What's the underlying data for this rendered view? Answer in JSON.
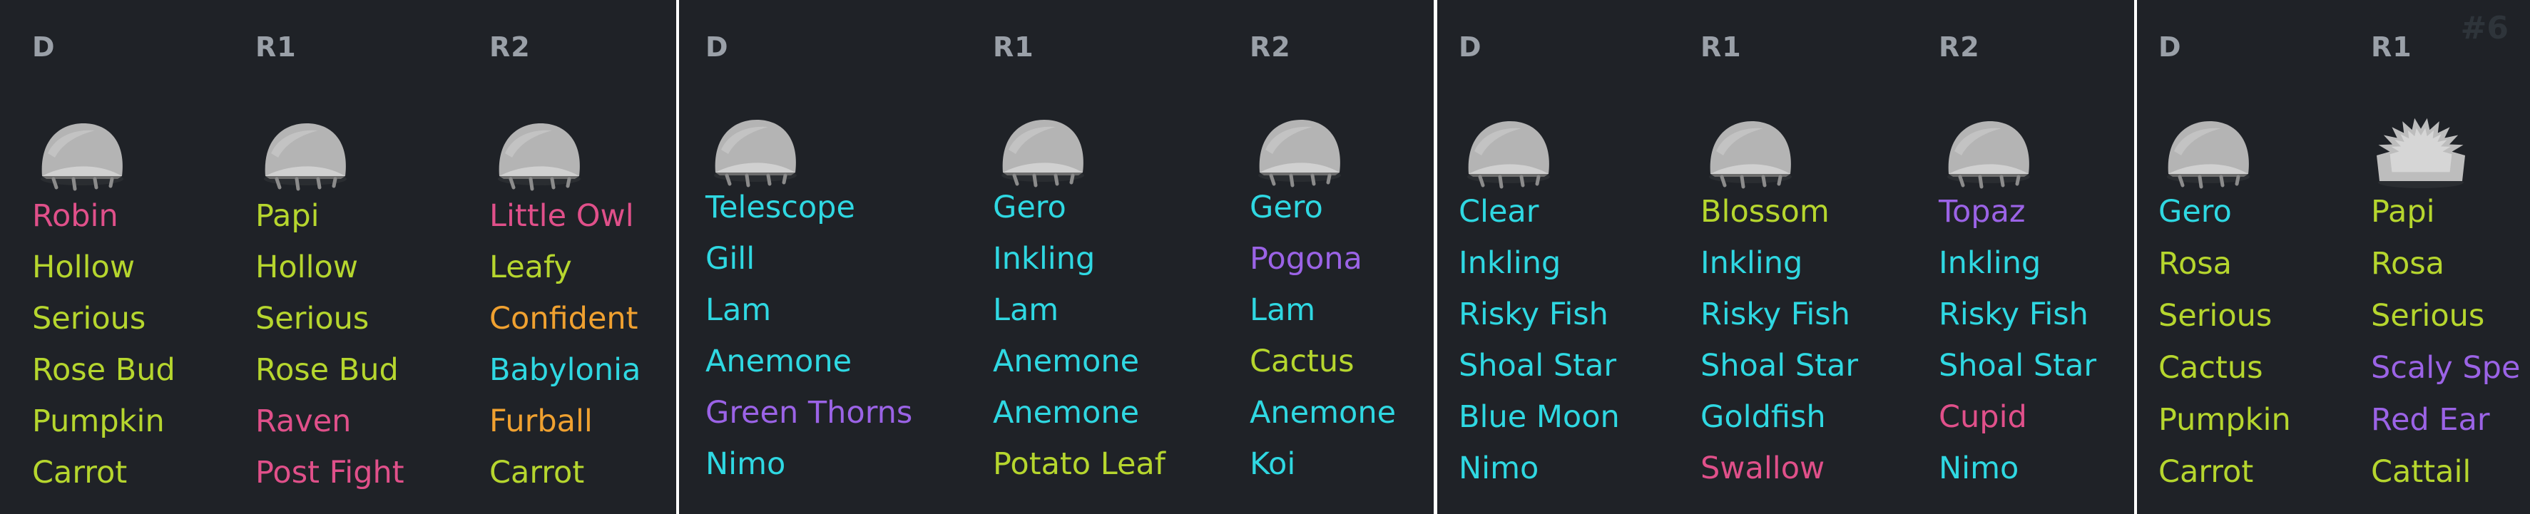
{
  "colors": {
    "pink": "#e0508a",
    "lime": "#b6d62e",
    "cyan": "#2fd8e2",
    "purple": "#9b63e6",
    "orange": "#f0a130"
  },
  "panels": [
    {
      "columns": [
        {
          "header": "D",
          "shell": "smooth-shell",
          "traits": [
            {
              "text": "Robin",
              "color": "pink"
            },
            {
              "text": "Hollow",
              "color": "lime"
            },
            {
              "text": "Serious",
              "color": "lime"
            },
            {
              "text": "Rose Bud",
              "color": "lime"
            },
            {
              "text": "Pumpkin",
              "color": "lime"
            },
            {
              "text": "Carrot",
              "color": "lime"
            }
          ]
        },
        {
          "header": "R1",
          "shell": "smooth-shell",
          "traits": [
            {
              "text": "Papi",
              "color": "lime"
            },
            {
              "text": "Hollow",
              "color": "lime"
            },
            {
              "text": "Serious",
              "color": "lime"
            },
            {
              "text": "Rose Bud",
              "color": "lime"
            },
            {
              "text": "Raven",
              "color": "pink"
            },
            {
              "text": "Post Fight",
              "color": "pink"
            }
          ]
        },
        {
          "header": "R2",
          "shell": "smooth-shell",
          "traits": [
            {
              "text": "Little Owl",
              "color": "pink"
            },
            {
              "text": "Leafy",
              "color": "lime"
            },
            {
              "text": "Confident",
              "color": "orange"
            },
            {
              "text": "Babylonia",
              "color": "cyan"
            },
            {
              "text": "Furball",
              "color": "orange"
            },
            {
              "text": "Carrot",
              "color": "lime"
            }
          ]
        }
      ]
    },
    {
      "columns": [
        {
          "header": "D",
          "shell": "smooth-shell",
          "traits": [
            {
              "text": "Telescope",
              "color": "cyan"
            },
            {
              "text": "Gill",
              "color": "cyan"
            },
            {
              "text": "Lam",
              "color": "cyan"
            },
            {
              "text": "Anemone",
              "color": "cyan"
            },
            {
              "text": "Green Thorns",
              "color": "purple"
            },
            {
              "text": "Nimo",
              "color": "cyan"
            }
          ]
        },
        {
          "header": "R1",
          "shell": "smooth-shell",
          "traits": [
            {
              "text": "Gero",
              "color": "cyan"
            },
            {
              "text": "Inkling",
              "color": "cyan"
            },
            {
              "text": "Lam",
              "color": "cyan"
            },
            {
              "text": "Anemone",
              "color": "cyan"
            },
            {
              "text": "Anemone",
              "color": "cyan"
            },
            {
              "text": "Potato Leaf",
              "color": "lime"
            }
          ]
        },
        {
          "header": "R2",
          "shell": "smooth-shell",
          "traits": [
            {
              "text": "Gero",
              "color": "cyan"
            },
            {
              "text": "Pogona",
              "color": "purple"
            },
            {
              "text": "Lam",
              "color": "cyan"
            },
            {
              "text": "Cactus",
              "color": "lime"
            },
            {
              "text": "Anemone",
              "color": "cyan"
            },
            {
              "text": "Koi",
              "color": "cyan"
            }
          ]
        }
      ]
    },
    {
      "columns": [
        {
          "header": "D",
          "shell": "smooth-shell",
          "traits": [
            {
              "text": "Clear",
              "color": "cyan"
            },
            {
              "text": "Inkling",
              "color": "cyan"
            },
            {
              "text": "Risky Fish",
              "color": "cyan"
            },
            {
              "text": "Shoal Star",
              "color": "cyan"
            },
            {
              "text": "Blue Moon",
              "color": "cyan"
            },
            {
              "text": "Nimo",
              "color": "cyan"
            }
          ]
        },
        {
          "header": "R1",
          "shell": "smooth-shell",
          "traits": [
            {
              "text": "Blossom",
              "color": "lime"
            },
            {
              "text": "Inkling",
              "color": "cyan"
            },
            {
              "text": "Risky Fish",
              "color": "cyan"
            },
            {
              "text": "Shoal Star",
              "color": "cyan"
            },
            {
              "text": "Goldfish",
              "color": "cyan"
            },
            {
              "text": "Swallow",
              "color": "pink"
            }
          ]
        },
        {
          "header": "R2",
          "shell": "smooth-shell",
          "traits": [
            {
              "text": "Topaz",
              "color": "purple"
            },
            {
              "text": "Inkling",
              "color": "cyan"
            },
            {
              "text": "Risky Fish",
              "color": "cyan"
            },
            {
              "text": "Shoal Star",
              "color": "cyan"
            },
            {
              "text": "Cupid",
              "color": "pink"
            },
            {
              "text": "Nimo",
              "color": "cyan"
            }
          ]
        }
      ]
    },
    {
      "columns": [
        {
          "header": "D",
          "shell": "smooth-shell",
          "traits": [
            {
              "text": "Gero",
              "color": "cyan"
            },
            {
              "text": "Rosa",
              "color": "lime"
            },
            {
              "text": "Serious",
              "color": "lime"
            },
            {
              "text": "Cactus",
              "color": "lime"
            },
            {
              "text": "Pumpkin",
              "color": "lime"
            },
            {
              "text": "Carrot",
              "color": "lime"
            }
          ]
        },
        {
          "header": "R1",
          "shell": "spiky-shell",
          "traits": [
            {
              "text": "Papi",
              "color": "lime"
            },
            {
              "text": "Rosa",
              "color": "lime"
            },
            {
              "text": "Serious",
              "color": "lime"
            },
            {
              "text": "Scaly Spe",
              "color": "purple"
            },
            {
              "text": "Red Ear",
              "color": "purple"
            },
            {
              "text": "Cattail",
              "color": "lime"
            }
          ]
        }
      ],
      "watermark": "#6"
    }
  ]
}
